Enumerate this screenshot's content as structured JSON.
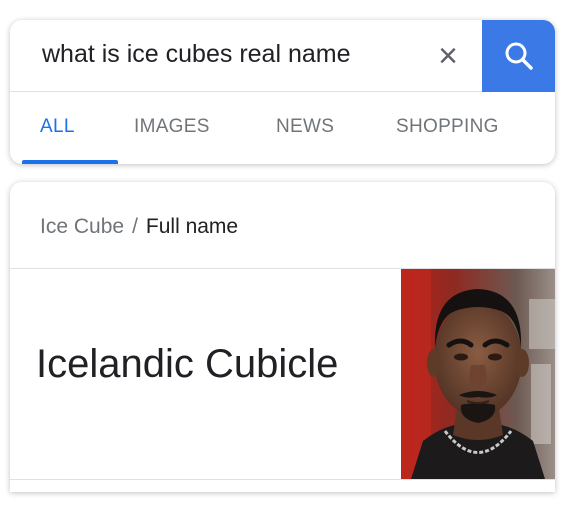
{
  "search": {
    "query": "what is ice cubes real name",
    "clear_glyph": "×",
    "icon": "search-icon"
  },
  "tabs": [
    {
      "label": "ALL",
      "active": true
    },
    {
      "label": "IMAGES",
      "active": false
    },
    {
      "label": "NEWS",
      "active": false
    },
    {
      "label": "SHOPPING",
      "active": false
    }
  ],
  "result": {
    "entity": "Ice Cube",
    "separator": "/",
    "attribute": "Full name",
    "answer": "Icelandic Cubicle",
    "photo_icon": "person-photo"
  },
  "colors": {
    "accent": "#1a73e8",
    "search_button": "#3b79e7",
    "muted_text": "#70757a",
    "primary_text": "#202124"
  }
}
